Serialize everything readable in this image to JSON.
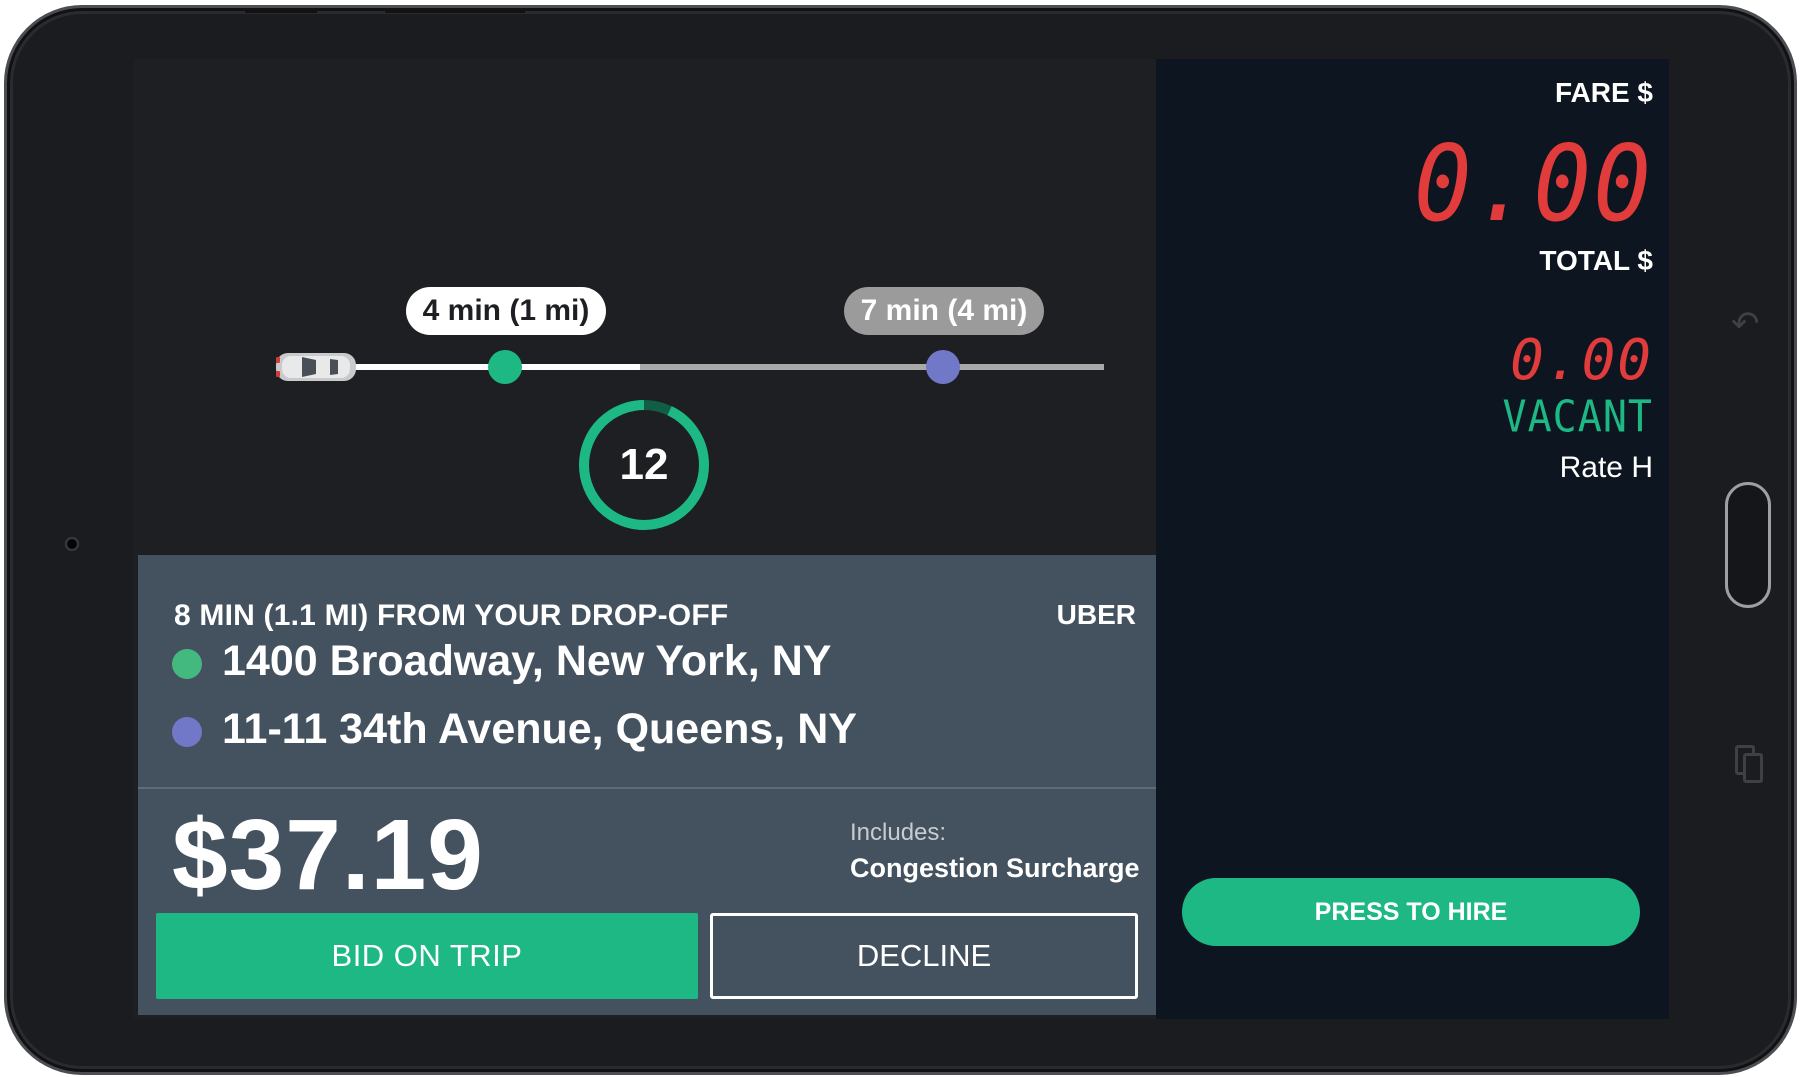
{
  "route": {
    "pickup_eta": "4 min (1 mi)",
    "dropoff_eta": "7 min (4 mi)",
    "countdown": "12",
    "countdown_fraction_remaining": 0.93
  },
  "trip": {
    "distance_note": "8 MIN (1.1 MI) FROM YOUR DROP-OFF",
    "provider": "UBER",
    "pickup_address": "1400 Broadway, New York, NY",
    "dropoff_address": "11-11 34th Avenue, Queens, NY",
    "price": "$37.19",
    "includes_label": "Includes:",
    "includes_item": "Congestion Surcharge",
    "bid_label": "BID ON TRIP",
    "decline_label": "DECLINE"
  },
  "meter": {
    "fare_label": "FARE $",
    "fare_value": "0.00",
    "total_label": "TOTAL $",
    "total_value": "0.00",
    "status": "VACANT",
    "rate": "Rate H",
    "hire_label": "PRESS TO HIRE"
  },
  "colors": {
    "accent_green": "#1db884",
    "dropoff_purple": "#7278c8",
    "meter_red": "#e23b3b",
    "card_bg": "#44525f",
    "meter_bg": "#0d1620"
  },
  "icons": {
    "car": "car-icon",
    "back": "back-icon",
    "recent_apps": "recent-apps-icon"
  }
}
